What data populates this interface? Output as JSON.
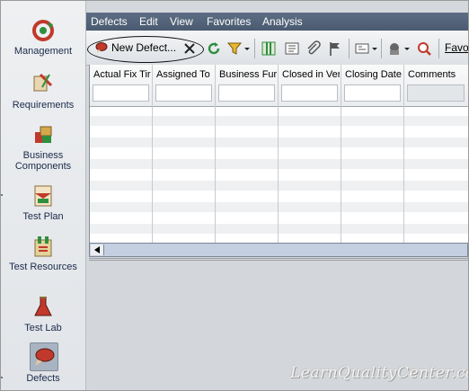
{
  "sidebar": {
    "items": [
      {
        "label": "Management",
        "icon": "management-icon"
      },
      {
        "label": "Requirements",
        "icon": "requirements-icon"
      },
      {
        "label": "Business Components",
        "icon": "business-components-icon"
      },
      {
        "label": "Test Plan",
        "icon": "test-plan-icon"
      },
      {
        "label": "Test Resources",
        "icon": "test-resources-icon"
      },
      {
        "label": "Test Lab",
        "icon": "test-lab-icon"
      },
      {
        "label": "Defects",
        "icon": "defects-icon",
        "active": true
      }
    ]
  },
  "menu": {
    "items": [
      "Defects",
      "Edit",
      "View",
      "Favorites",
      "Analysis"
    ]
  },
  "toolbar": {
    "new_defect_label": "New Defect...",
    "favorites_label": "Favo"
  },
  "grid": {
    "columns": [
      "Actual Fix Tir",
      "Assigned To",
      "Business Fur",
      "Closed in Ver",
      "Closing Date",
      "Comments"
    ]
  },
  "watermark": "LearnQualityCenter.com",
  "colors": {
    "menubar": "#526278",
    "selected_nav": "#a9b4c2",
    "scrollbar": "#c4cfe2"
  }
}
